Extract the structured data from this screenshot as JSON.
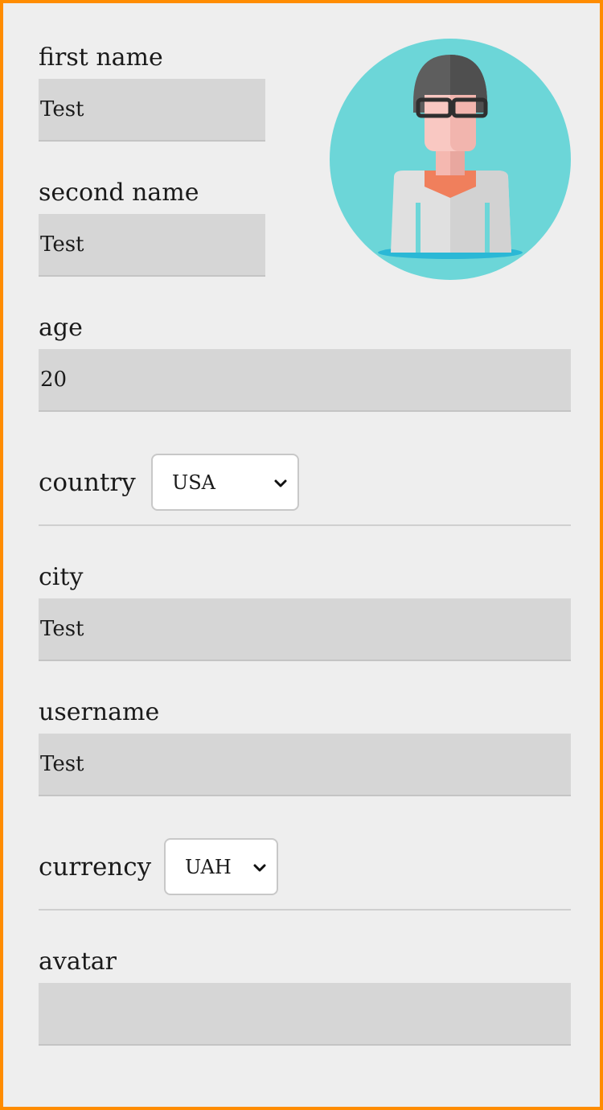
{
  "form": {
    "first_name": {
      "label": "first name",
      "value": "Test"
    },
    "second_name": {
      "label": "second name",
      "value": "Test"
    },
    "age": {
      "label": "age",
      "value": "20"
    },
    "country": {
      "label": "country",
      "selected": "USA"
    },
    "city": {
      "label": "city",
      "value": "Test"
    },
    "username": {
      "label": "username",
      "value": "Test"
    },
    "currency": {
      "label": "currency",
      "selected": "UAH"
    },
    "avatar": {
      "label": "avatar",
      "value": ""
    }
  },
  "colors": {
    "frame_border": "#ff8c00",
    "background": "#eeeeee",
    "field_background": "#d6d6d6",
    "avatar_circle": "#6cd6d8"
  },
  "icons": {
    "profile_picture": "avatar-illustration",
    "dropdown": "chevron-down-icon"
  }
}
